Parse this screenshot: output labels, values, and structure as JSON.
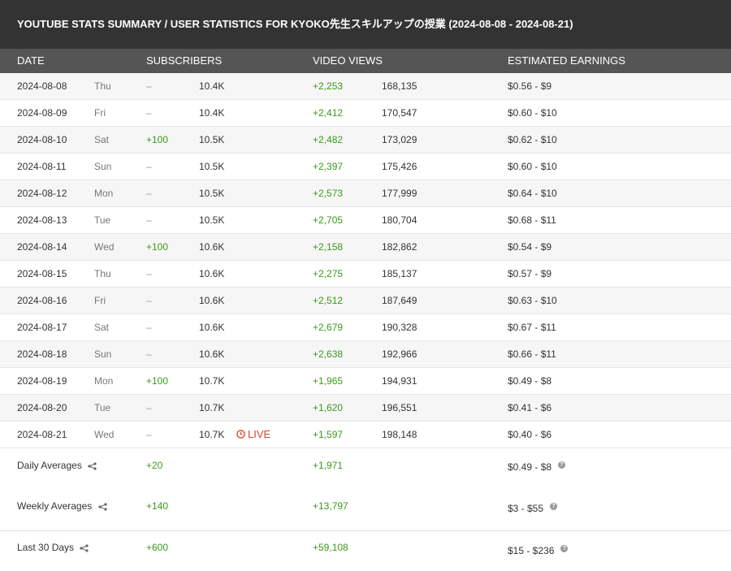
{
  "title": "YOUTUBE STATS SUMMARY / USER STATISTICS FOR KYOKO先生スキルアップの授業 (2024-08-08 - 2024-08-21)",
  "columns": {
    "date": "DATE",
    "subscribers": "SUBSCRIBERS",
    "video_views": "VIDEO VIEWS",
    "earnings": "ESTIMATED EARNINGS"
  },
  "rows": [
    {
      "date": "2024-08-08",
      "day": "Thu",
      "sub_delta": "–",
      "subs": "10.4K",
      "live": "",
      "view_delta": "+2,253",
      "views": "168,135",
      "earn": "$0.56  -  $9"
    },
    {
      "date": "2024-08-09",
      "day": "Fri",
      "sub_delta": "–",
      "subs": "10.4K",
      "live": "",
      "view_delta": "+2,412",
      "views": "170,547",
      "earn": "$0.60  -  $10"
    },
    {
      "date": "2024-08-10",
      "day": "Sat",
      "sub_delta": "+100",
      "subs": "10.5K",
      "live": "",
      "view_delta": "+2,482",
      "views": "173,029",
      "earn": "$0.62  -  $10"
    },
    {
      "date": "2024-08-11",
      "day": "Sun",
      "sub_delta": "–",
      "subs": "10.5K",
      "live": "",
      "view_delta": "+2,397",
      "views": "175,426",
      "earn": "$0.60  -  $10"
    },
    {
      "date": "2024-08-12",
      "day": "Mon",
      "sub_delta": "–",
      "subs": "10.5K",
      "live": "",
      "view_delta": "+2,573",
      "views": "177,999",
      "earn": "$0.64  -  $10"
    },
    {
      "date": "2024-08-13",
      "day": "Tue",
      "sub_delta": "–",
      "subs": "10.5K",
      "live": "",
      "view_delta": "+2,705",
      "views": "180,704",
      "earn": "$0.68  -  $11"
    },
    {
      "date": "2024-08-14",
      "day": "Wed",
      "sub_delta": "+100",
      "subs": "10.6K",
      "live": "",
      "view_delta": "+2,158",
      "views": "182,862",
      "earn": "$0.54  -  $9"
    },
    {
      "date": "2024-08-15",
      "day": "Thu",
      "sub_delta": "–",
      "subs": "10.6K",
      "live": "",
      "view_delta": "+2,275",
      "views": "185,137",
      "earn": "$0.57  -  $9"
    },
    {
      "date": "2024-08-16",
      "day": "Fri",
      "sub_delta": "–",
      "subs": "10.6K",
      "live": "",
      "view_delta": "+2,512",
      "views": "187,649",
      "earn": "$0.63  -  $10"
    },
    {
      "date": "2024-08-17",
      "day": "Sat",
      "sub_delta": "–",
      "subs": "10.6K",
      "live": "",
      "view_delta": "+2,679",
      "views": "190,328",
      "earn": "$0.67  -  $11"
    },
    {
      "date": "2024-08-18",
      "day": "Sun",
      "sub_delta": "–",
      "subs": "10.6K",
      "live": "",
      "view_delta": "+2,638",
      "views": "192,966",
      "earn": "$0.66  -  $11"
    },
    {
      "date": "2024-08-19",
      "day": "Mon",
      "sub_delta": "+100",
      "subs": "10.7K",
      "live": "",
      "view_delta": "+1,965",
      "views": "194,931",
      "earn": "$0.49  -  $8"
    },
    {
      "date": "2024-08-20",
      "day": "Tue",
      "sub_delta": "–",
      "subs": "10.7K",
      "live": "",
      "view_delta": "+1,620",
      "views": "196,551",
      "earn": "$0.41  -  $6"
    },
    {
      "date": "2024-08-21",
      "day": "Wed",
      "sub_delta": "–",
      "subs": "10.7K",
      "live": "LIVE",
      "view_delta": "+1,597",
      "views": "198,148",
      "earn": "$0.40  -  $6"
    }
  ],
  "summary": {
    "daily": {
      "label": "Daily Averages",
      "sub_delta": "+20",
      "view_delta": "+1,971",
      "earn": "$0.49  -  $8"
    },
    "weekly": {
      "label": "Weekly Averages",
      "sub_delta": "+140",
      "view_delta": "+13,797",
      "earn": "$3  -  $55"
    },
    "last30": {
      "label": "Last 30 Days",
      "sub_delta": "+600",
      "view_delta": "+59,108",
      "earn": "$15  -  $236"
    }
  },
  "help_glyph": "?",
  "colors": {
    "positive": "#3a9a1a",
    "live": "#d9432b",
    "title_bg": "#333333",
    "header_bg": "#555555"
  }
}
